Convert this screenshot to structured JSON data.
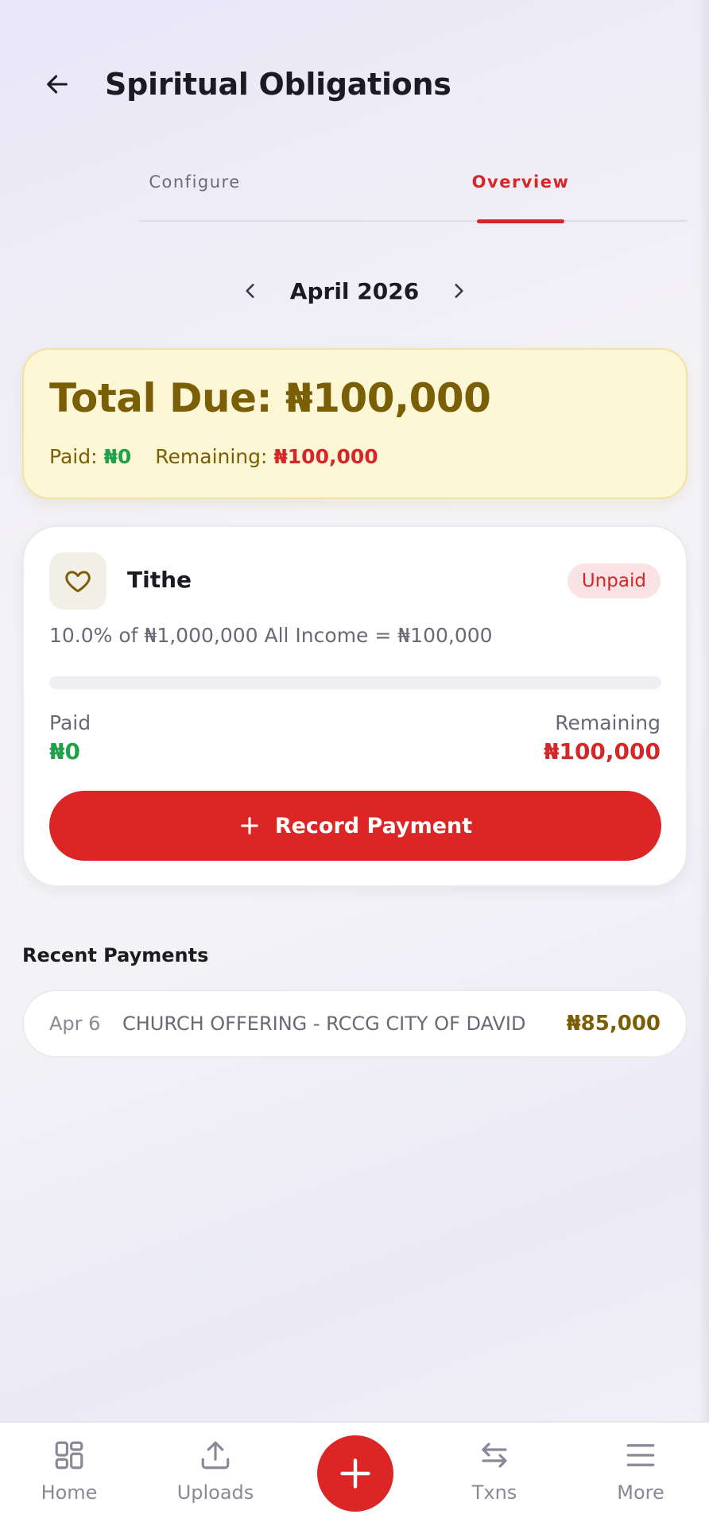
{
  "header": {
    "title": "Spiritual Obligations"
  },
  "tabs": [
    {
      "label": "Configure",
      "active": false
    },
    {
      "label": "Overview",
      "active": true
    }
  ],
  "month_nav": {
    "label": "April 2026"
  },
  "summary": {
    "total_prefix": "Total Due: ",
    "total_value": "₦100,000",
    "paid_label": "Paid: ",
    "paid_value": "₦0",
    "remaining_label": "Remaining: ",
    "remaining_value": "₦100,000"
  },
  "obligation": {
    "name": "Tithe",
    "status": "Unpaid",
    "calculation": "10.0% of ₦1,000,000 All Income = ₦100,000",
    "progress": 0,
    "paid_label": "Paid",
    "paid_value": "₦0",
    "remaining_label": "Remaining",
    "remaining_value": "₦100,000",
    "button_label": "Record Payment"
  },
  "recent": {
    "title": "Recent Payments",
    "items": [
      {
        "date": "Apr 6",
        "description": "CHURCH OFFERING - RCCG CITY OF DAVID",
        "amount": "₦85,000"
      }
    ]
  },
  "bottom_nav": {
    "home": "Home",
    "uploads": "Uploads",
    "txns": "Txns",
    "more": "More"
  },
  "colors": {
    "accent_red": "#dc2626",
    "success_green": "#1fa24a",
    "gold": "#7a5f07",
    "summary_bg": "#fef7d6"
  },
  "icons": {
    "back": "arrow-left-icon",
    "prev_month": "chevron-left-icon",
    "next_month": "chevron-right-icon",
    "tithe": "heart-icon",
    "add": "plus-icon",
    "home": "grid-icon",
    "uploads": "upload-icon",
    "txns": "swap-arrows-icon",
    "more": "menu-icon"
  }
}
